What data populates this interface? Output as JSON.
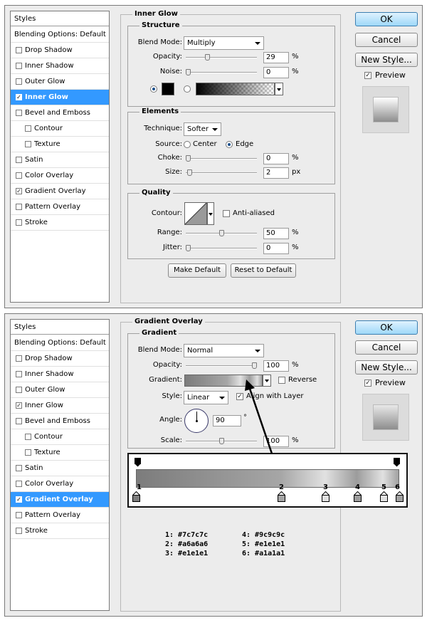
{
  "top": {
    "styles_list": {
      "header": "Styles",
      "items": [
        {
          "label": "Blending Options: Default",
          "checkbox": false,
          "checked": false,
          "selected": false,
          "sub": false
        },
        {
          "label": "Drop Shadow",
          "checkbox": true,
          "checked": false,
          "selected": false,
          "sub": false
        },
        {
          "label": "Inner Shadow",
          "checkbox": true,
          "checked": false,
          "selected": false,
          "sub": false
        },
        {
          "label": "Outer Glow",
          "checkbox": true,
          "checked": false,
          "selected": false,
          "sub": false
        },
        {
          "label": "Inner Glow",
          "checkbox": true,
          "checked": true,
          "selected": true,
          "sub": false
        },
        {
          "label": "Bevel and Emboss",
          "checkbox": true,
          "checked": false,
          "selected": false,
          "sub": false
        },
        {
          "label": "Contour",
          "checkbox": true,
          "checked": false,
          "selected": false,
          "sub": true
        },
        {
          "label": "Texture",
          "checkbox": true,
          "checked": false,
          "selected": false,
          "sub": true
        },
        {
          "label": "Satin",
          "checkbox": true,
          "checked": false,
          "selected": false,
          "sub": false
        },
        {
          "label": "Color Overlay",
          "checkbox": true,
          "checked": false,
          "selected": false,
          "sub": false
        },
        {
          "label": "Gradient Overlay",
          "checkbox": true,
          "checked": true,
          "selected": false,
          "sub": false
        },
        {
          "label": "Pattern Overlay",
          "checkbox": true,
          "checked": false,
          "selected": false,
          "sub": false
        },
        {
          "label": "Stroke",
          "checkbox": true,
          "checked": false,
          "selected": false,
          "sub": false
        }
      ]
    },
    "title": "Inner Glow",
    "structure": {
      "legend": "Structure",
      "blend_mode_label": "Blend Mode:",
      "blend_mode_value": "Multiply",
      "opacity_label": "Opacity:",
      "opacity_value": "29",
      "opacity_fraction": 0.29,
      "opacity_unit": "%",
      "noise_label": "Noise:",
      "noise_value": "0",
      "noise_fraction": 0.0,
      "noise_unit": "%",
      "color_radio_on": true,
      "swatch_color": "#000000"
    },
    "elements": {
      "legend": "Elements",
      "technique_label": "Technique:",
      "technique_value": "Softer",
      "source_label": "Source:",
      "source_center": "Center",
      "source_edge": "Edge",
      "source_selected": "Edge",
      "choke_label": "Choke:",
      "choke_value": "0",
      "choke_fraction": 0.0,
      "choke_unit": "%",
      "size_label": "Size:",
      "size_value": "2",
      "size_fraction": 0.02,
      "size_unit": "px"
    },
    "quality": {
      "legend": "Quality",
      "contour_label": "Contour:",
      "anti_aliased_label": "Anti-aliased",
      "anti_aliased": false,
      "range_label": "Range:",
      "range_value": "50",
      "range_fraction": 0.5,
      "range_unit": "%",
      "jitter_label": "Jitter:",
      "jitter_value": "0",
      "jitter_fraction": 0.0,
      "jitter_unit": "%"
    },
    "make_default": "Make Default",
    "reset_to_default": "Reset to Default",
    "buttons": {
      "ok": "OK",
      "cancel": "Cancel",
      "new_style": "New Style...",
      "preview": "Preview",
      "preview_checked": true
    }
  },
  "bottom": {
    "styles_list": {
      "header": "Styles",
      "items": [
        {
          "label": "Blending Options: Default",
          "checkbox": false,
          "checked": false,
          "selected": false,
          "sub": false
        },
        {
          "label": "Drop Shadow",
          "checkbox": true,
          "checked": false,
          "selected": false,
          "sub": false
        },
        {
          "label": "Inner Shadow",
          "checkbox": true,
          "checked": false,
          "selected": false,
          "sub": false
        },
        {
          "label": "Outer Glow",
          "checkbox": true,
          "checked": false,
          "selected": false,
          "sub": false
        },
        {
          "label": "Inner Glow",
          "checkbox": true,
          "checked": true,
          "selected": false,
          "sub": false
        },
        {
          "label": "Bevel and Emboss",
          "checkbox": true,
          "checked": false,
          "selected": false,
          "sub": false
        },
        {
          "label": "Contour",
          "checkbox": true,
          "checked": false,
          "selected": false,
          "sub": true
        },
        {
          "label": "Texture",
          "checkbox": true,
          "checked": false,
          "selected": false,
          "sub": true
        },
        {
          "label": "Satin",
          "checkbox": true,
          "checked": false,
          "selected": false,
          "sub": false
        },
        {
          "label": "Color Overlay",
          "checkbox": true,
          "checked": false,
          "selected": false,
          "sub": false
        },
        {
          "label": "Gradient Overlay",
          "checkbox": true,
          "checked": true,
          "selected": true,
          "sub": false
        },
        {
          "label": "Pattern Overlay",
          "checkbox": true,
          "checked": false,
          "selected": false,
          "sub": false
        },
        {
          "label": "Stroke",
          "checkbox": true,
          "checked": false,
          "selected": false,
          "sub": false
        }
      ]
    },
    "title": "Gradient Overlay",
    "gradient_group": {
      "legend": "Gradient",
      "blend_mode_label": "Blend Mode:",
      "blend_mode_value": "Normal",
      "opacity_label": "Opacity:",
      "opacity_value": "100",
      "opacity_fraction": 1.0,
      "opacity_unit": "%",
      "gradient_label": "Gradient:",
      "reverse_label": "Reverse",
      "reverse": false,
      "style_label": "Style:",
      "style_value": "Linear",
      "align_label": "Align with Layer",
      "align": true,
      "angle_label": "Angle:",
      "angle_value": "90",
      "angle_unit": "°",
      "scale_label": "Scale:",
      "scale_value": "100",
      "scale_fraction": 0.5,
      "scale_unit": "%"
    },
    "gradient_stops": [
      {
        "label": "1",
        "color": "#7c7c7c",
        "position": 0.0
      },
      {
        "label": "2",
        "color": "#a6a6a6",
        "position": 0.55
      },
      {
        "label": "3",
        "color": "#e1e1e1",
        "position": 0.72
      },
      {
        "label": "4",
        "color": "#9c9c9c",
        "position": 0.84
      },
      {
        "label": "5",
        "color": "#e1e1e1",
        "position": 0.94
      },
      {
        "label": "6",
        "color": "#a1a1a1",
        "position": 1.0
      }
    ],
    "color_legend": [
      {
        "text": "1: #7c7c7c"
      },
      {
        "text": "2: #a6a6a6"
      },
      {
        "text": "3: #e1e1e1"
      },
      {
        "text": "4: #9c9c9c"
      },
      {
        "text": "5: #e1e1e1"
      },
      {
        "text": "6: #a1a1a1"
      }
    ],
    "buttons": {
      "ok": "OK",
      "cancel": "Cancel",
      "new_style": "New Style...",
      "preview": "Preview",
      "preview_checked": true
    }
  }
}
